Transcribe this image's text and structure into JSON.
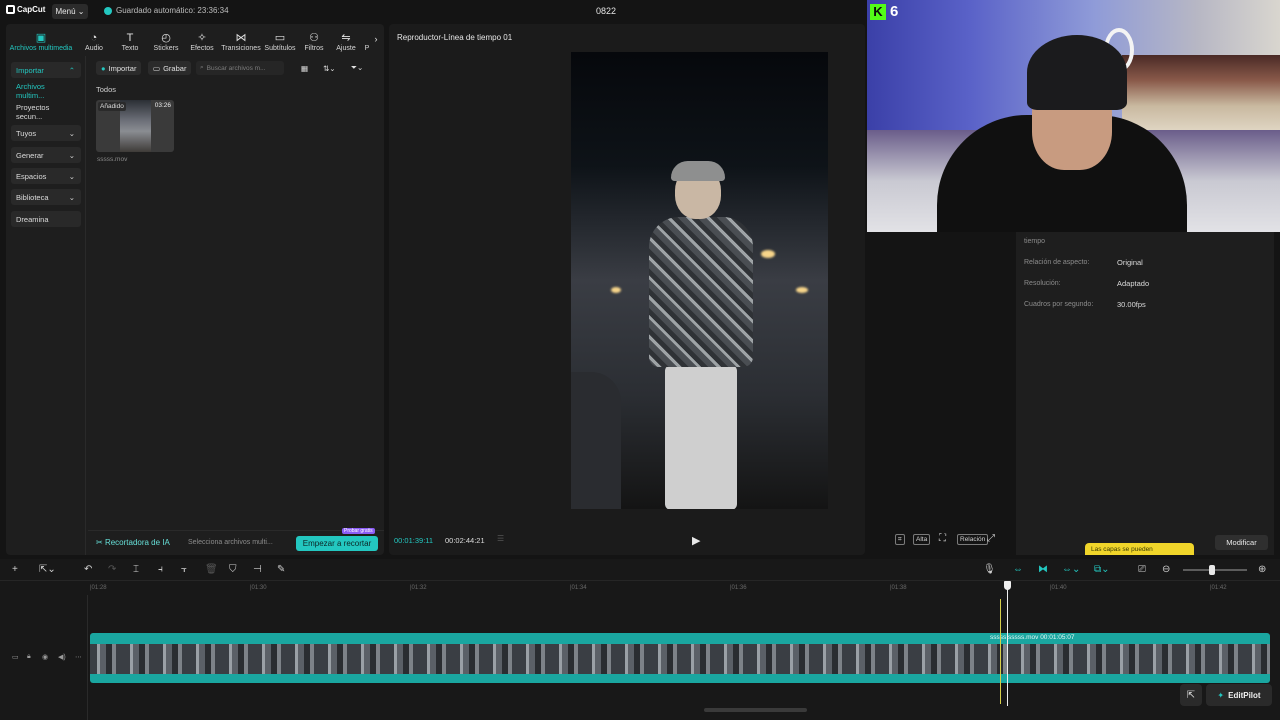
{
  "topbar": {
    "logo_text": "CapCut",
    "menu_label": "Menú",
    "autosave_text": "Guardado automático: 23:36:34",
    "project_name": "0822"
  },
  "toolbar": {
    "items": [
      {
        "label": "Archivos multimedia",
        "icon": "media-icon"
      },
      {
        "label": "Audio",
        "icon": "audio-icon"
      },
      {
        "label": "Texto",
        "icon": "text-icon"
      },
      {
        "label": "Stickers",
        "icon": "sticker-icon"
      },
      {
        "label": "Efectos",
        "icon": "effects-icon"
      },
      {
        "label": "Transiciones",
        "icon": "transitions-icon"
      },
      {
        "label": "Subtítulos",
        "icon": "captions-icon"
      },
      {
        "label": "Filtros",
        "icon": "filters-icon"
      },
      {
        "label": "Ajuste",
        "icon": "adjust-icon"
      },
      {
        "label": "P",
        "icon": "more-icon"
      }
    ]
  },
  "sidebar": {
    "items": [
      {
        "label": "Importar",
        "chevron": "⌃"
      },
      {
        "label": "Archivos multim..."
      },
      {
        "label": "Proyectos secun..."
      },
      {
        "label": "Tuyos",
        "chevron": "⌄"
      },
      {
        "label": "Generar",
        "chevron": "⌄"
      },
      {
        "label": "Espacios",
        "chevron": "⌄"
      },
      {
        "label": "Biblioteca",
        "chevron": "⌄"
      },
      {
        "label": "Dreamina"
      }
    ]
  },
  "media": {
    "import_label": "Importar",
    "record_label": "Grabar",
    "search_placeholder": "Buscar archivos m...",
    "section_label": "Todos",
    "item": {
      "tag": "Añadido",
      "duration": "03:26",
      "filename": "sssss.mov"
    }
  },
  "ai_bar": {
    "title": "Recortadora de IA",
    "hint": "Selecciona archivos multi...",
    "button": "Empezar a recortar",
    "badge": "Probar gratis"
  },
  "player": {
    "title": "Reproductor-Línea de tiempo 01",
    "current_time": "00:01:39:11",
    "total_time": "00:02:44:21",
    "ratio_label": "Relación",
    "quality_label": "Alta"
  },
  "webcam": {
    "badge_letter": "K",
    "badge_count": "6"
  },
  "properties": {
    "section": "tiempo",
    "rows": [
      {
        "label": "Relación de aspecto:",
        "value": "Original"
      },
      {
        "label": "Resolución:",
        "value": "Adaptado"
      },
      {
        "label": "Cuadros por segundo:",
        "value": "30.00fps"
      }
    ],
    "tooltip": "Las capas se pueden",
    "modify_label": "Modificar"
  },
  "timeline": {
    "ruler": [
      "|01:28",
      "|01:30",
      "|01:32",
      "|01:34",
      "|01:36",
      "|01:38",
      "|01:40",
      "|01:42"
    ],
    "clip_name": "sssss  sssss.mov  00:01:05:07",
    "zoom_level": 0.45
  },
  "editpilot_label": "EditPilot",
  "colors": {
    "accent": "#23c7c0",
    "clip": "#1aa6a0",
    "tooltip": "#f0d52a"
  }
}
